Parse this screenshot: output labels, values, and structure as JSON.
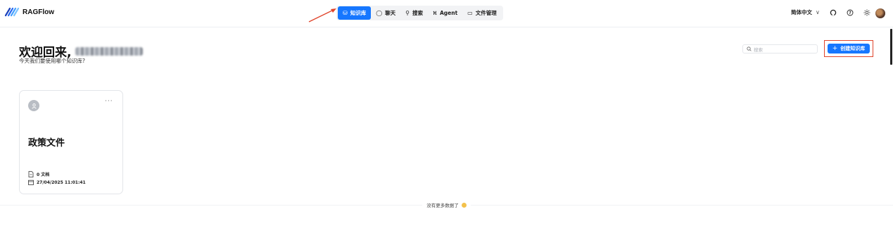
{
  "app": {
    "name": "RAGFlow"
  },
  "nav": {
    "items": [
      {
        "label": "知识库",
        "icon": "database-icon",
        "active": true
      },
      {
        "label": "聊天",
        "icon": "chat-icon",
        "active": false
      },
      {
        "label": "搜索",
        "icon": "search-icon",
        "active": false
      },
      {
        "label": "Agent",
        "icon": "agent-icon",
        "active": false
      },
      {
        "label": "文件管理",
        "icon": "folder-icon",
        "active": false
      }
    ]
  },
  "header_tools": {
    "language": "简体中文",
    "icons": [
      "github-icon",
      "help-icon",
      "theme-sun-icon",
      "user-avatar"
    ]
  },
  "page": {
    "welcome": "欢迎回来,",
    "subtitle": "今天我们要使用哪个知识库?",
    "search_placeholder": "搜索",
    "create_button": "创建知识库",
    "create_icon": "+"
  },
  "knowledge_bases": [
    {
      "title": "政策文件",
      "docs": "0 文档",
      "date": "27/04/2025 11:01:41"
    }
  ],
  "footer": {
    "no_more": "没有更多数据了"
  },
  "colors": {
    "accent": "#1677ff",
    "annotation": "#e0442b"
  }
}
